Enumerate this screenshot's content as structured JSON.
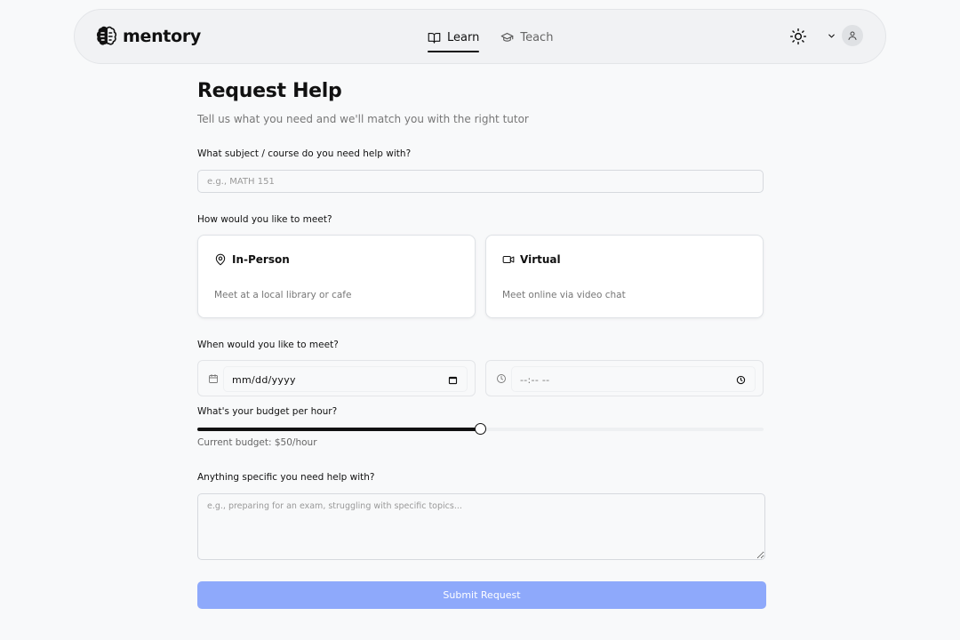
{
  "brand": {
    "name": "mentory",
    "icon": "brain-icon"
  },
  "nav": {
    "tabs": [
      {
        "label": "Learn",
        "icon": "book-open-icon",
        "active": true
      },
      {
        "label": "Teach",
        "icon": "graduation-cap-icon",
        "active": false
      }
    ],
    "theme_icon": "sun-icon",
    "user_icon": "user-icon"
  },
  "form": {
    "title": "Request Help",
    "subtitle": "Tell us what you need and we'll match you with the right tutor",
    "subject": {
      "label": "What subject / course do you need help with?",
      "placeholder": "e.g., MATH 151",
      "value": ""
    },
    "meet": {
      "label": "How would you like to meet?",
      "options": [
        {
          "title": "In-Person",
          "description": "Meet at a local library or cafe",
          "icon": "map-pin-icon"
        },
        {
          "title": "Virtual",
          "description": "Meet online via video chat",
          "icon": "video-icon"
        }
      ]
    },
    "when": {
      "label": "When would you like to meet?",
      "date_placeholder": "mm/dd/yyyy",
      "time_placeholder": "--:-- --"
    },
    "budget": {
      "label": "What's your budget per hour?",
      "current_text": "Current budget: $50/hour",
      "value_fraction": 0.5
    },
    "notes": {
      "label": "Anything specific you need help with?",
      "placeholder": "e.g., preparing for an exam, struggling with specific topics..."
    },
    "submit_label": "Submit Request"
  },
  "colors": {
    "accent": "#8ea9fb",
    "background": "#f8f9fa",
    "text": "#111111"
  }
}
